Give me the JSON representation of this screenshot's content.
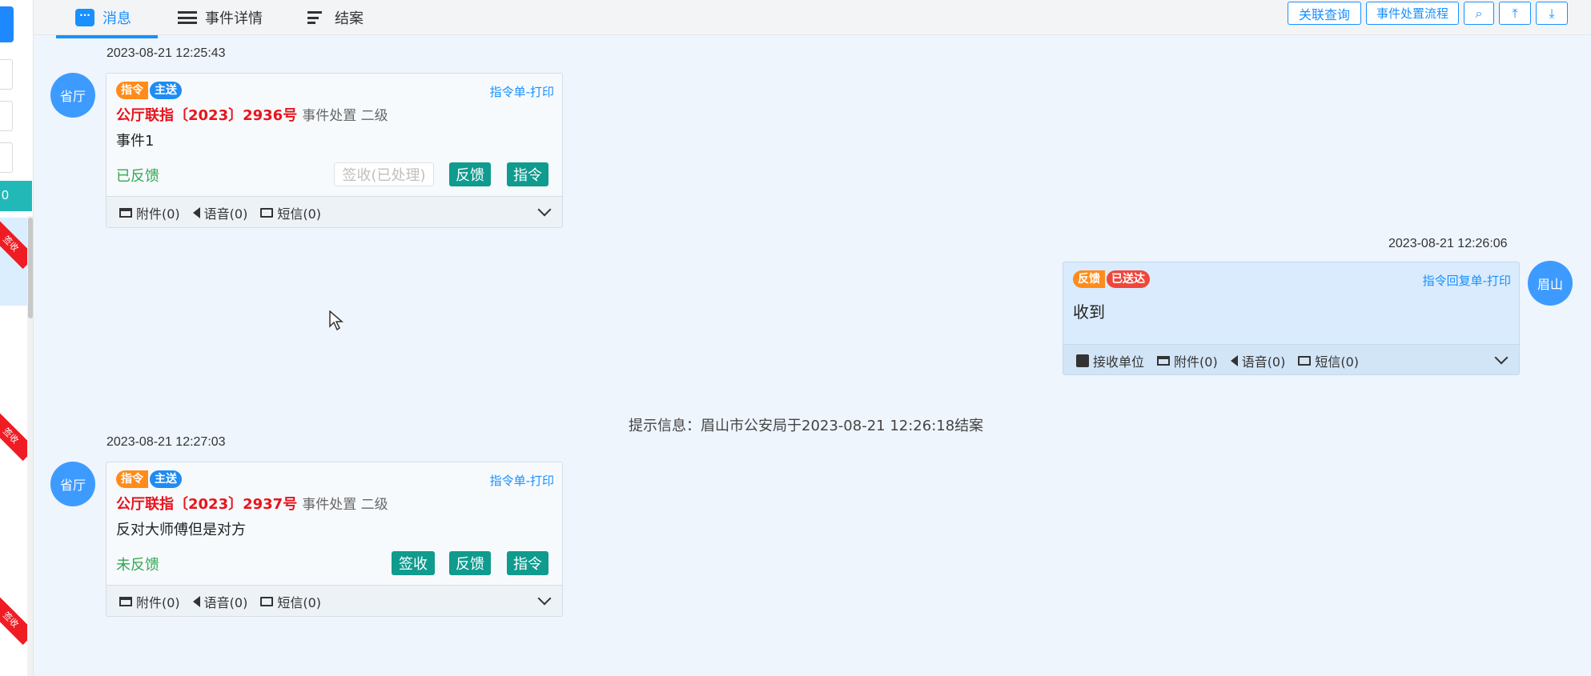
{
  "sidebar": {
    "count": "0",
    "ribbon_label": "签收"
  },
  "tabs": [
    {
      "label": "消息",
      "icon": "chat-icon"
    },
    {
      "label": "事件详情",
      "icon": "list-icon"
    },
    {
      "label": "结案",
      "icon": "checklist-icon"
    }
  ],
  "toolbar": {
    "related_query": "关联查询",
    "process_flow": "事件处置流程",
    "search_icon": "🔍",
    "to_top_icon": "⤒",
    "to_bottom_icon": "⤓"
  },
  "messages": [
    {
      "time": "2023-08-21 12:25:43",
      "sender": "省厅",
      "badges": [
        "指令",
        "主送"
      ],
      "print_link": "指令单-打印",
      "order_no": "公厅联指〔2023〕2936号",
      "order_meta": "事件处置 二级",
      "event": "事件1",
      "status": "已反馈",
      "sign_label": "签收(已处理)",
      "feedback_label": "反馈",
      "command_label": "指令",
      "attachments": "附件(0)",
      "voice": "语音(0)",
      "sms": "短信(0)"
    },
    {
      "time": "2023-08-21 12:26:06",
      "sender": "眉山",
      "badges": [
        "反馈",
        "已送达"
      ],
      "print_link": "指令回复单-打印",
      "content": "收到",
      "receiver_label": "接收单位",
      "attachments": "附件(0)",
      "voice": "语音(0)",
      "sms": "短信(0)"
    },
    {
      "time": "2023-08-21 12:27:03",
      "sender": "省厅",
      "badges": [
        "指令",
        "主送"
      ],
      "print_link": "指令单-打印",
      "order_no": "公厅联指〔2023〕2937号",
      "order_meta": "事件处置 二级",
      "event": "反对大师傅但是对方",
      "status": "未反馈",
      "sign_label": "签收",
      "feedback_label": "反馈",
      "command_label": "指令",
      "attachments": "附件(0)",
      "voice": "语音(0)",
      "sms": "短信(0)"
    }
  ],
  "hint": "提示信息：眉山市公安局于2023-08-21 12:26:18结案",
  "colors": {
    "accent": "#1890ff",
    "teal": "#0f9b8e",
    "order_red": "#e8141c",
    "status_green": "#32a852",
    "badge_orange": "#ff8c1a"
  }
}
